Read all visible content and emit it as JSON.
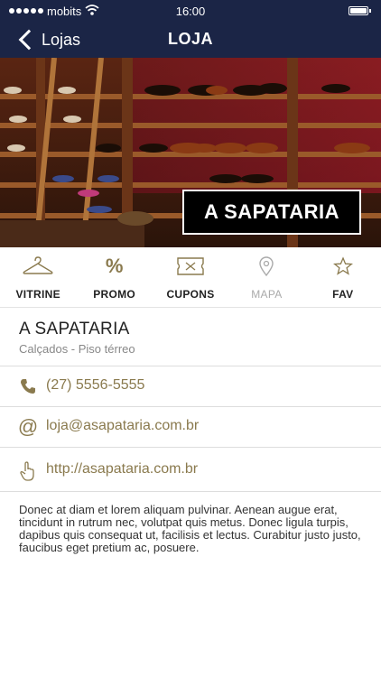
{
  "status_bar": {
    "carrier": "mobits",
    "time": "16:00"
  },
  "nav": {
    "back_label": "Lojas",
    "title": "LOJA"
  },
  "hero": {
    "badge_text": "A SAPATARIA"
  },
  "tabs": [
    {
      "label": "VITRINE",
      "icon": "hanger-icon",
      "enabled": true
    },
    {
      "label": "PROMO",
      "icon": "percent-icon",
      "enabled": true
    },
    {
      "label": "CUPONS",
      "icon": "coupon-icon",
      "enabled": true
    },
    {
      "label": "MAPA",
      "icon": "map-pin-icon",
      "enabled": false
    },
    {
      "label": "FAV",
      "icon": "star-icon",
      "enabled": true
    }
  ],
  "shop": {
    "name": "A SAPATARIA",
    "subtitle": "Calçados - Piso térreo",
    "phone": "(27) 5556-5555",
    "email": "loja@asapataria.com.br",
    "website": "http://asapataria.com.br",
    "description": "Donec at diam et lorem aliquam pulvinar. Aenean augue erat, tincidunt in rutrum nec, volutpat quis metus. Donec ligula turpis, dapibus quis consequat ut, facilisis et lectus. Curabitur justo justo, faucibus eget pretium ac, posuere."
  },
  "colors": {
    "nav_background": "#1b2546",
    "accent_gold": "#8a7a4e",
    "disabled_gray": "#aaaaaa"
  }
}
